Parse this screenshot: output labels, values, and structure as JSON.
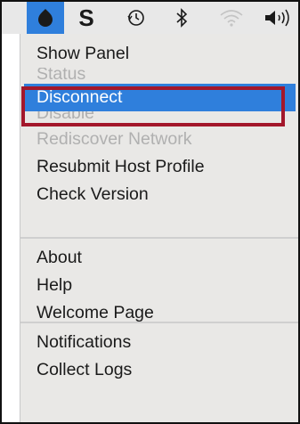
{
  "menubar": {
    "icons": [
      "app-status-icon",
      "s-logo-icon",
      "time-machine-icon",
      "bluetooth-icon",
      "wifi-icon",
      "volume-icon"
    ],
    "s_logo_text": "S",
    "active_color": "#2f7fdc"
  },
  "menu": {
    "group1": [
      {
        "label": "Show Panel",
        "state": "enabled"
      },
      {
        "label": "Status",
        "state": "disabled"
      },
      {
        "label": "Disconnect",
        "state": "selected"
      },
      {
        "label": "Disable",
        "state": "disabled"
      },
      {
        "label": "Rediscover Network",
        "state": "disabled"
      },
      {
        "label": "Resubmit Host Profile",
        "state": "enabled"
      },
      {
        "label": "Check Version",
        "state": "enabled"
      }
    ],
    "group2": [
      {
        "label": "About",
        "state": "enabled"
      },
      {
        "label": "Help",
        "state": "enabled"
      },
      {
        "label": "Welcome Page",
        "state": "enabled"
      }
    ],
    "group3": [
      {
        "label": "Notifications",
        "state": "enabled"
      },
      {
        "label": "Collect Logs",
        "state": "enabled"
      }
    ]
  },
  "colors": {
    "selection": "#2f7fdc",
    "highlight_border": "#a3172b",
    "menu_background": "#e9e8e6",
    "disabled_text": "#b0b0b0"
  }
}
